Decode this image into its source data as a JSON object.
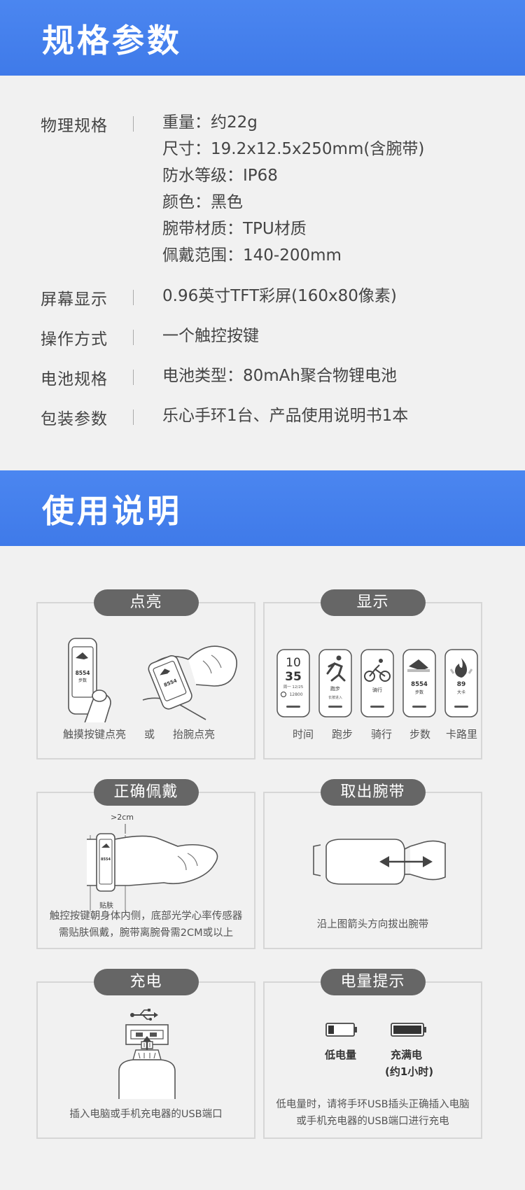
{
  "section1": {
    "title": "规格参数",
    "rows": [
      {
        "label": "物理规格",
        "values": [
          "重量：约22g",
          "尺寸：19.2x12.5x250mm(含腕带)",
          "防水等级：IP68",
          "颜色：黑色",
          "腕带材质：TPU材质",
          "佩戴范围：140-200mm"
        ]
      },
      {
        "label": "屏幕显示",
        "values": [
          "0.96英寸TFT彩屏(160x80像素)"
        ]
      },
      {
        "label": "操作方式",
        "values": [
          "一个触控按键"
        ]
      },
      {
        "label": "电池规格",
        "values": [
          "电池类型：80mAh聚合物锂电池"
        ]
      },
      {
        "label": "包装参数",
        "values": [
          "乐心手环1台、产品使用说明书1本"
        ]
      }
    ]
  },
  "section2": {
    "title": "使用说明",
    "panels": {
      "light_up": {
        "title": "点亮",
        "caption_touch": "触摸按键点亮",
        "caption_or": "或",
        "caption_wrist": "抬腕点亮",
        "screen_steps_value": "8554",
        "screen_steps_unit": "步数"
      },
      "display": {
        "title": "显示",
        "screens": [
          {
            "label": "时间",
            "hour": "10",
            "minute": "35",
            "date": "周一 12/25",
            "steps": "12800"
          },
          {
            "label": "跑步",
            "text": "跑步",
            "sub": "长按进入"
          },
          {
            "label": "骑行",
            "text": "骑行"
          },
          {
            "label": "步数",
            "value": "8554",
            "unit": "步数"
          },
          {
            "label": "卡路里",
            "value": "89",
            "unit": "大卡"
          }
        ]
      },
      "wear": {
        "title": "正确佩戴",
        "gap_label": ">2cm",
        "skin_label": "贴肤",
        "note_line1": "触控按键朝身体内侧，底部光学心率传感器",
        "note_line2": "需贴肤佩戴，腕带离腕骨需2CM或以上"
      },
      "remove": {
        "title": "取出腕带",
        "note": "沿上图箭头方向拔出腕带"
      },
      "charge": {
        "title": "充电",
        "note": "插入电脑或手机充电器的USB端口"
      },
      "battery": {
        "title": "电量提示",
        "low_label": "低电量",
        "full_label": "充满电",
        "full_sub": "(约1小时)",
        "note_line1": "低电量时，请将手环USB插头正确插入电脑",
        "note_line2": "或手机充电器的USB端口进行充电"
      }
    }
  },
  "colors": {
    "banner": "#4b86f0",
    "pill": "#666666",
    "background": "#f1f1f1"
  }
}
